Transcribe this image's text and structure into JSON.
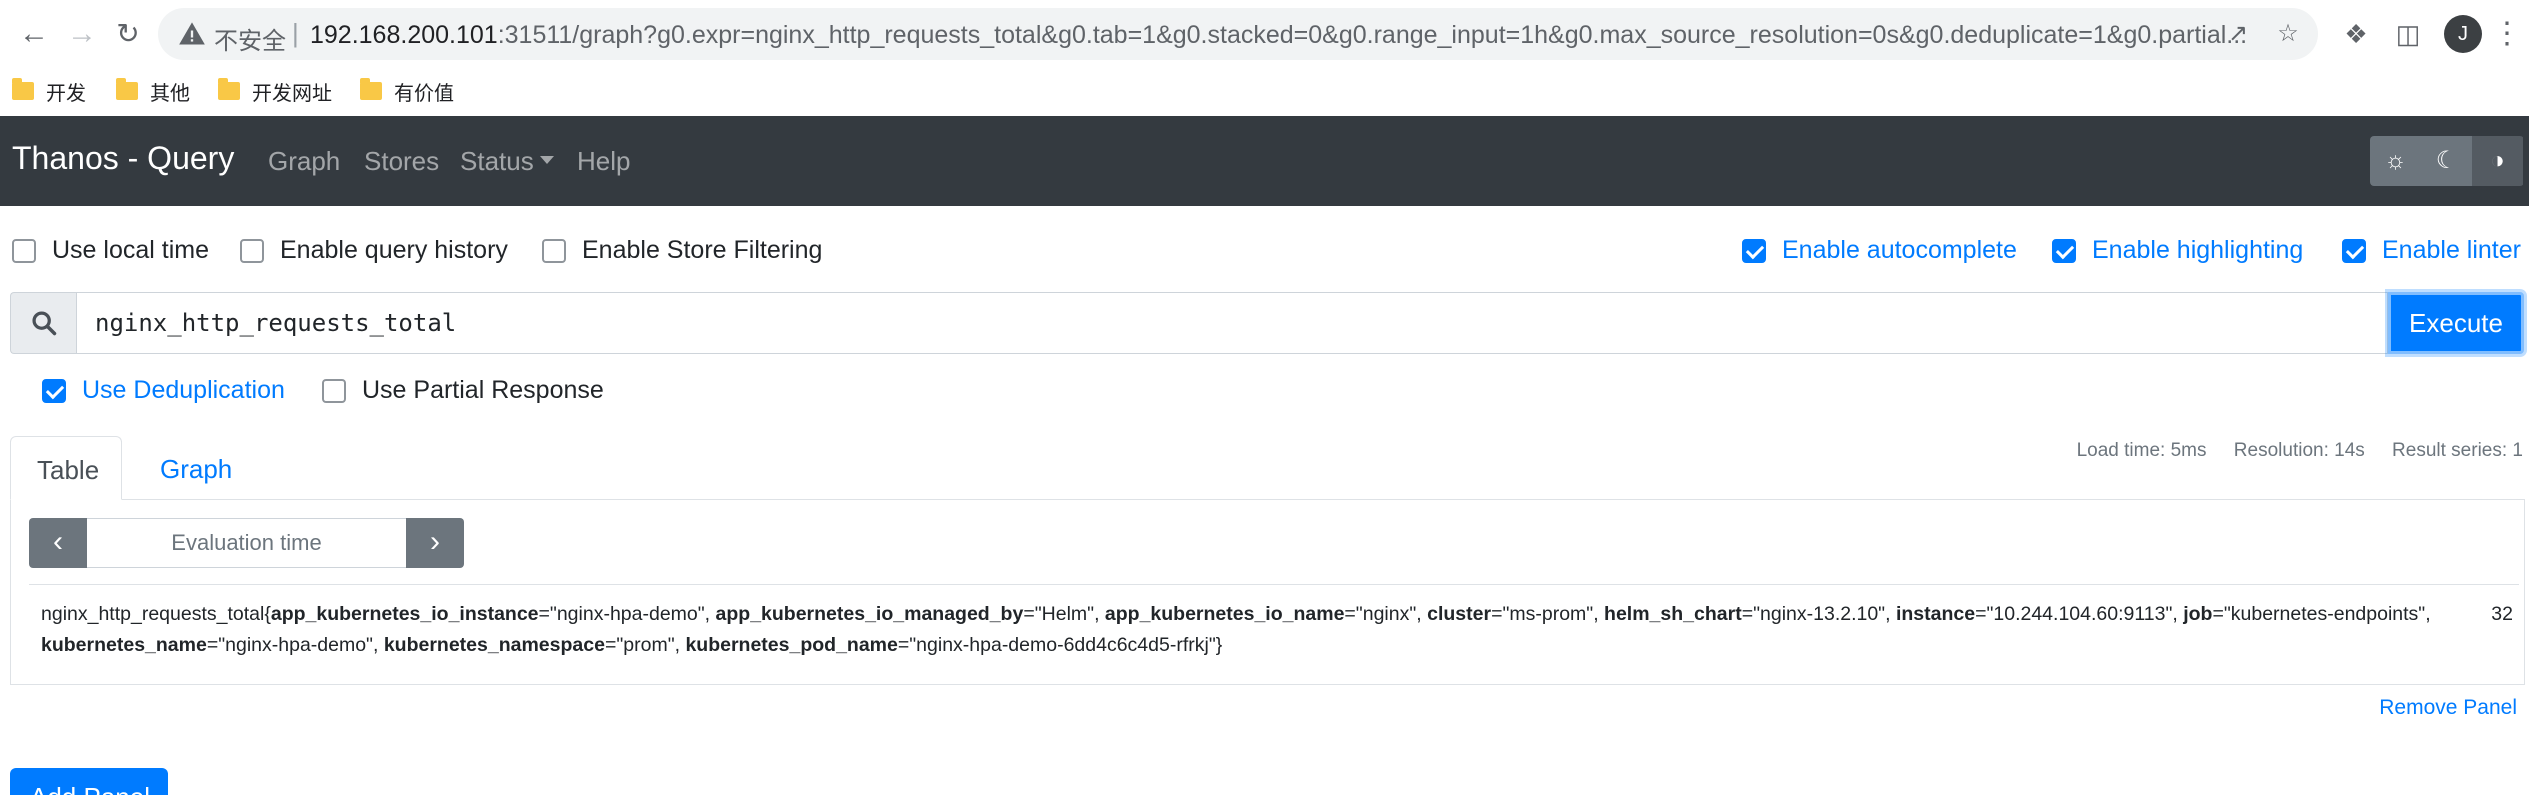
{
  "browser": {
    "insecure_label": "不安全",
    "url_host": "192.168.200.101",
    "url_rest": ":31511/graph?g0.expr=nginx_http_requests_total&g0.tab=1&g0.stacked=0&g0.range_input=1h&g0.max_source_resolution=0s&g0.deduplicate=1&g0.partial...",
    "profile_initial": "J",
    "bookmarks": [
      "开发",
      "其他",
      "开发网址",
      "有价值"
    ]
  },
  "navbar": {
    "brand": "Thanos - Query",
    "links": [
      "Graph",
      "Stores",
      "Status",
      "Help"
    ]
  },
  "options": {
    "local_time": "Use local time",
    "query_history": "Enable query history",
    "store_filtering": "Enable Store Filtering",
    "autocomplete": "Enable autocomplete",
    "highlighting": "Enable highlighting",
    "linter": "Enable linter"
  },
  "query": {
    "expression": "nginx_http_requests_total",
    "execute_label": "Execute"
  },
  "panel_options": {
    "deduplication": "Use Deduplication",
    "partial_response": "Use Partial Response"
  },
  "panel": {
    "tabs": [
      "Table",
      "Graph"
    ],
    "load_time": "Load time: 5ms",
    "resolution": "Resolution: 14s",
    "result_series": "Result series: 1",
    "eval_placeholder": "Evaluation time",
    "metric_name": "nginx_http_requests_total",
    "labels": [
      {
        "key": "app_kubernetes_io_instance",
        "value": "nginx-hpa-demo"
      },
      {
        "key": "app_kubernetes_io_managed_by",
        "value": "Helm"
      },
      {
        "key": "app_kubernetes_io_name",
        "value": "nginx"
      },
      {
        "key": "cluster",
        "value": "ms-prom"
      },
      {
        "key": "helm_sh_chart",
        "value": "nginx-13.2.10"
      },
      {
        "key": "instance",
        "value": "10.244.104.60:9113"
      },
      {
        "key": "job",
        "value": "kubernetes-endpoints"
      },
      {
        "key": "kubernetes_name",
        "value": "nginx-hpa-demo"
      },
      {
        "key": "kubernetes_namespace",
        "value": "prom"
      },
      {
        "key": "kubernetes_pod_name",
        "value": "nginx-hpa-demo-6dd4c6c4d5-rfrkj"
      }
    ],
    "value": "32",
    "remove_label": "Remove Panel"
  },
  "add_panel_label": "Add Panel",
  "colors": {
    "navbar": "#343a40",
    "primary": "#007bff",
    "secondary": "#6c757d"
  }
}
